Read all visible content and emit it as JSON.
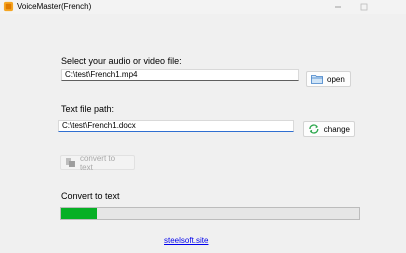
{
  "window": {
    "title": "VoiceMaster(French)",
    "controls": {
      "minimize": "—",
      "maximize": "☐"
    }
  },
  "audio_section": {
    "label": "Select your audio or video file:",
    "file_value": "C:\\test\\French1.mp4",
    "open_label": "open",
    "open_icon": "folder-icon"
  },
  "text_section": {
    "label": "Text file path:",
    "file_value": "C:\\test\\French1.docx",
    "change_label": "change",
    "change_icon": "refresh-icon"
  },
  "convert_button": {
    "label": "convert to text",
    "icon": "convert-icon",
    "enabled": false
  },
  "progress": {
    "label": "Convert to text",
    "value": 0.12,
    "color": "#06b025"
  },
  "footer": {
    "link_text": "steelsoft.site"
  }
}
